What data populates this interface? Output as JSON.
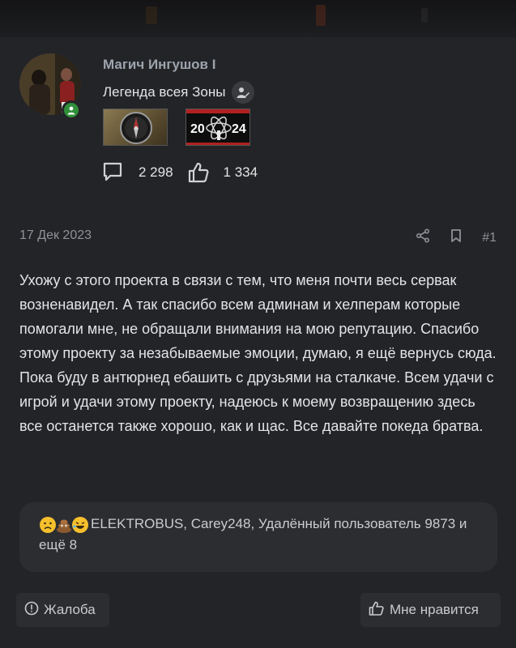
{
  "author": {
    "name": "Магич Ингушов I",
    "title": "Легенда всея Зоны",
    "status": "online"
  },
  "badges": [
    {
      "name": "compass-badge"
    },
    {
      "name": "2024-badge",
      "text_left": "20",
      "text_right": "24"
    }
  ],
  "stats": {
    "messages": "2 298",
    "reactions": "1 334"
  },
  "post": {
    "date": "17 Дек 2023",
    "number": "#1",
    "body": "Ухожу с этого проекта в связи с тем, что меня почти весь сервак возненавидел. А так спасибо всем админам и хелперам которые помогали мне, не обращали внимания на мою репутацию. Спасибо этому проекту за незабываемые эмоции, думаю, я ещё вернусь сюда. Пока буду в антюрнед ебашить с друзьями на сталкаче. Всем удачи с игрой и удачи этому проекту, надеюсь к моему возвращению здесь все останется также хорошо, как и щас. Все давайте покеда братва."
  },
  "reactions": {
    "icons": [
      "sad-emoji",
      "poop-emoji",
      "laughing-emoji"
    ],
    "text": "ELEKTROBUS, Carey248, Удалённый пользователь 9873 и ещё 8"
  },
  "buttons": {
    "report": "Жалоба",
    "like": "Мне нравится"
  },
  "colors": {
    "background": "#232427",
    "online": "#2f8f3a",
    "muted_text": "#8e9197"
  }
}
